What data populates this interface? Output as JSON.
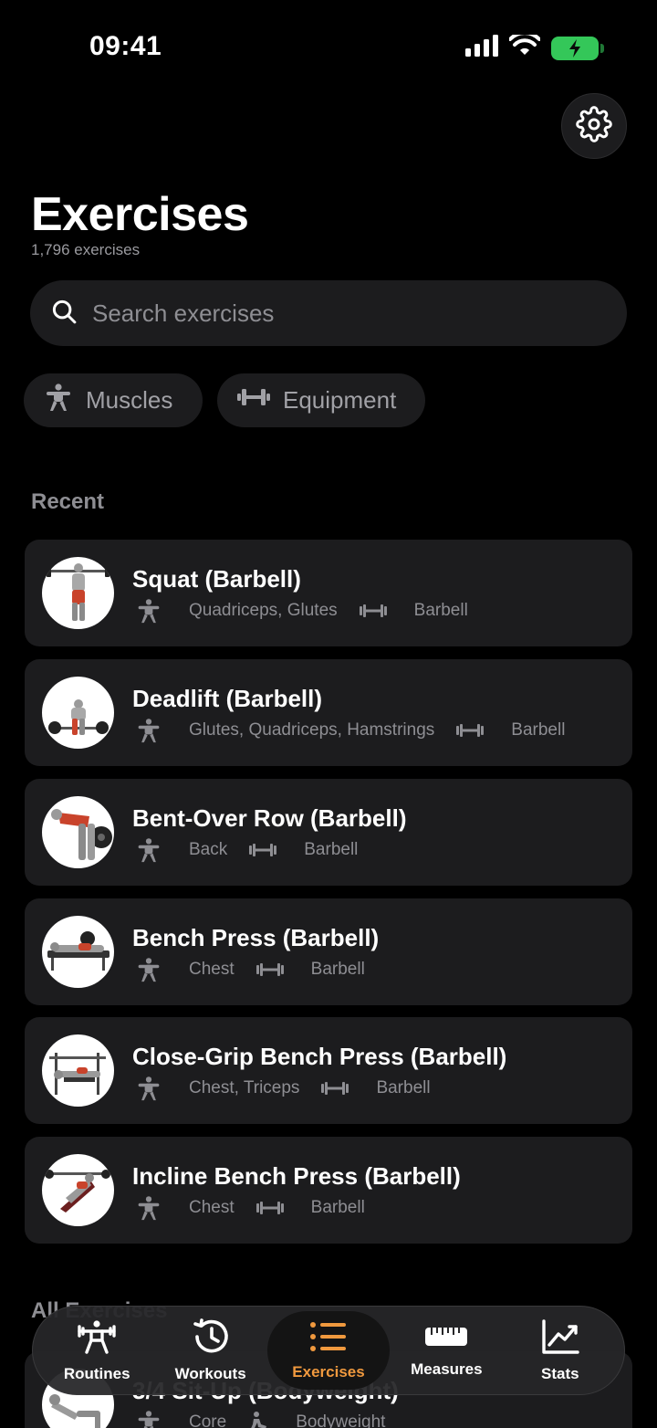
{
  "status": {
    "time": "09:41"
  },
  "header": {
    "title": "Exercises",
    "subtitle": "1,796 exercises"
  },
  "search": {
    "placeholder": "Search exercises",
    "value": ""
  },
  "filters": [
    {
      "label": "Muscles",
      "icon": "person-muscle-icon"
    },
    {
      "label": "Equipment",
      "icon": "dumbbell-icon"
    }
  ],
  "sections": {
    "recent": "Recent",
    "all": "All Exercises"
  },
  "recent": [
    {
      "name": "Squat (Barbell)",
      "muscles": "Quadriceps, Glutes",
      "equipment": "Barbell"
    },
    {
      "name": "Deadlift (Barbell)",
      "muscles": "Glutes, Quadriceps, Hamstrings",
      "equipment": "Barbell"
    },
    {
      "name": "Bent-Over Row (Barbell)",
      "muscles": "Back",
      "equipment": "Barbell"
    },
    {
      "name": "Bench Press (Barbell)",
      "muscles": "Chest",
      "equipment": "Barbell"
    },
    {
      "name": "Close-Grip Bench Press (Barbell)",
      "muscles": "Chest, Triceps",
      "equipment": "Barbell"
    },
    {
      "name": "Incline Bench Press (Barbell)",
      "muscles": "Chest",
      "equipment": "Barbell"
    }
  ],
  "all": [
    {
      "name": "3/4 Sit-Up (Bodyweight)",
      "muscles": "Core",
      "equipment": "Bodyweight"
    }
  ],
  "tabs": [
    {
      "label": "Routines",
      "icon": "routines-icon",
      "active": false
    },
    {
      "label": "Workouts",
      "icon": "history-icon",
      "active": false
    },
    {
      "label": "Exercises",
      "icon": "list-icon",
      "active": true
    },
    {
      "label": "Measures",
      "icon": "ruler-icon",
      "active": false
    },
    {
      "label": "Stats",
      "icon": "chart-icon",
      "active": false
    }
  ],
  "colors": {
    "background": "#000000",
    "card": "#1c1c1e",
    "accent": "#f0993e",
    "secondary_text": "#8e8e93",
    "battery": "#34c759"
  }
}
